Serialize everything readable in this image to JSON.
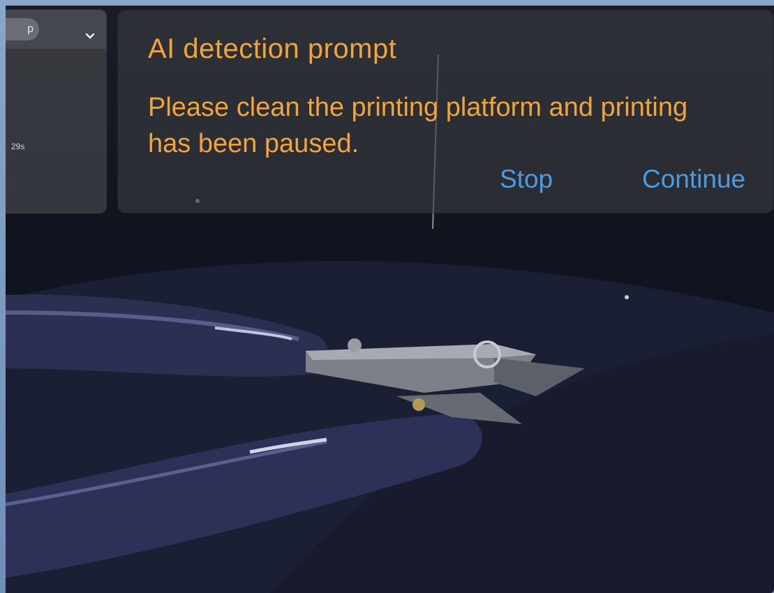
{
  "app": {
    "mode_label": "p",
    "elapsed_time": "29s"
  },
  "prompt": {
    "title": "AI detection prompt",
    "message": "Please clean the printing platform and printing has been paused.",
    "stop_label": "Stop",
    "continue_label": "Continue"
  },
  "icons": {
    "dropdown": "chevron-down-icon"
  },
  "colors": {
    "warning_text": "#f0a43a",
    "action_text": "#4c9be0",
    "panel_bg": "#3a3c42"
  }
}
